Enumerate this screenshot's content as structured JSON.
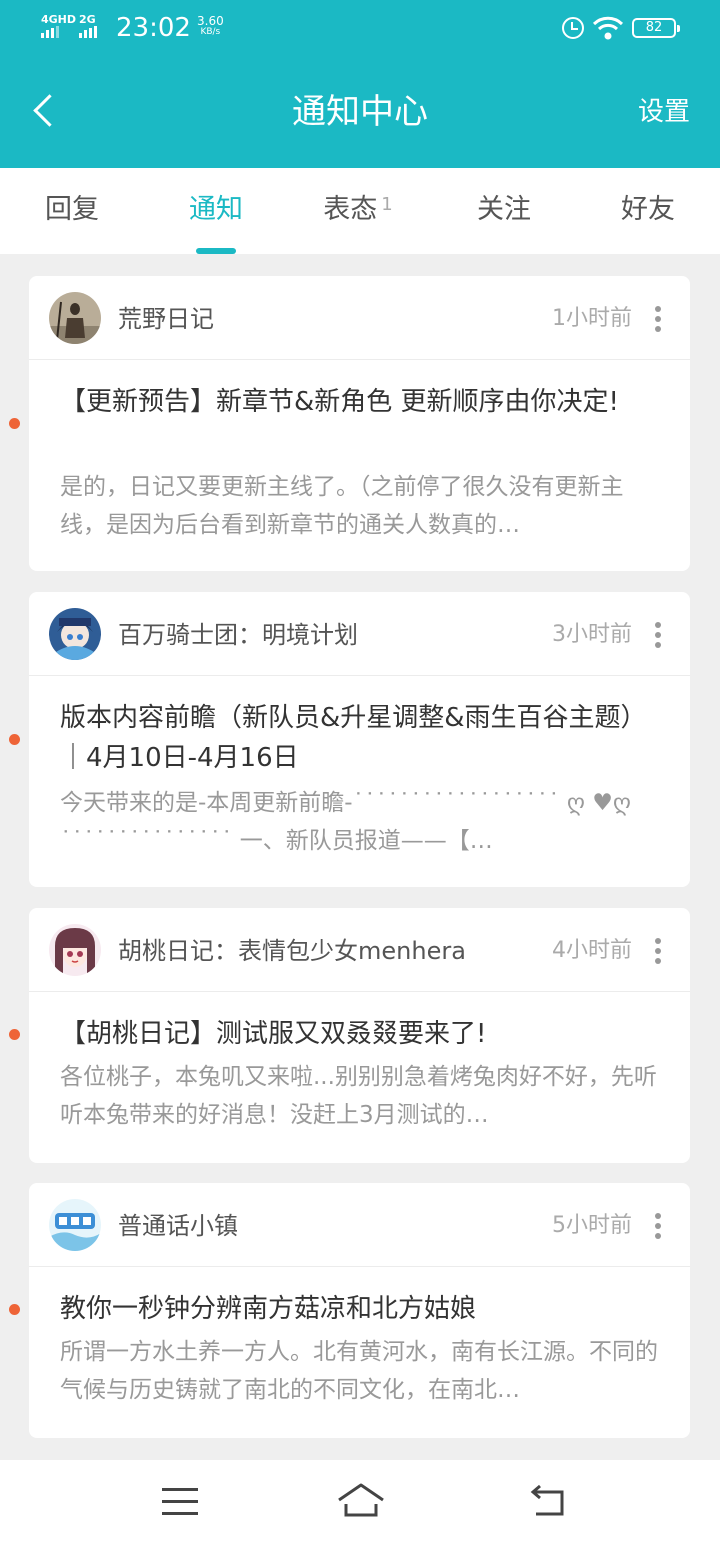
{
  "status_bar": {
    "net1": "4GHD",
    "net2": "2G",
    "time": "23:02",
    "speed_value": "3.60",
    "speed_unit": "KB/s",
    "battery": "82"
  },
  "header": {
    "title": "通知中心",
    "settings_label": "设置",
    "back_icon": "chevron-left-icon"
  },
  "tabs": [
    {
      "label": "回复",
      "badge": ""
    },
    {
      "label": "通知",
      "badge": "",
      "active": true
    },
    {
      "label": "表态",
      "badge": "1"
    },
    {
      "label": "关注",
      "badge": ""
    },
    {
      "label": "好友",
      "badge": ""
    }
  ],
  "accent_color": "#1bb9c4",
  "unread_dot_color": "#ee6437",
  "notifications": [
    {
      "author": "荒野日记",
      "time": "1小时前",
      "title": "【更新预告】新章节&新角色  更新顺序由你决定!",
      "excerpt": "是的，日记又要更新主线了。（之前停了很久没有更新主线，是因为后台看到新章节的通关人数真的…",
      "unread": true
    },
    {
      "author": "百万骑士团：明境计划",
      "time": "3小时前",
      "title": "版本内容前瞻（新队员&升星调整&雨生百谷主题）｜4月10日-4月16日",
      "excerpt": "今天带来的是-本周更新前瞻-˙˙˙˙˙˙˙˙˙˙˙˙˙˙˙˙˙˙ ღ ♥ღ ˙˙˙˙˙˙˙˙˙˙˙˙˙˙˙ 一、新队员报道——【…",
      "unread": true
    },
    {
      "author": "胡桃日记：表情包少女menhera",
      "time": "4小时前",
      "title": "【胡桃日记】测试服又双叒叕要来了!",
      "excerpt": "各位桃子，本兔叽又来啦...别别别急着烤兔肉好不好，先听听本兔带来的好消息！没赶上3月测试的…",
      "unread": true
    },
    {
      "author": "普通话小镇",
      "time": "5小时前",
      "title": "教你一秒钟分辨南方菇凉和北方姑娘",
      "excerpt": "所谓一方水土养一方人。北有黄河水，南有长江源。不同的气候与历史铸就了南北的不同文化，在南北…",
      "unread": true
    }
  ],
  "nav": {
    "menu_icon": "menu-icon",
    "home_icon": "home-icon",
    "back_icon": "back-icon"
  }
}
